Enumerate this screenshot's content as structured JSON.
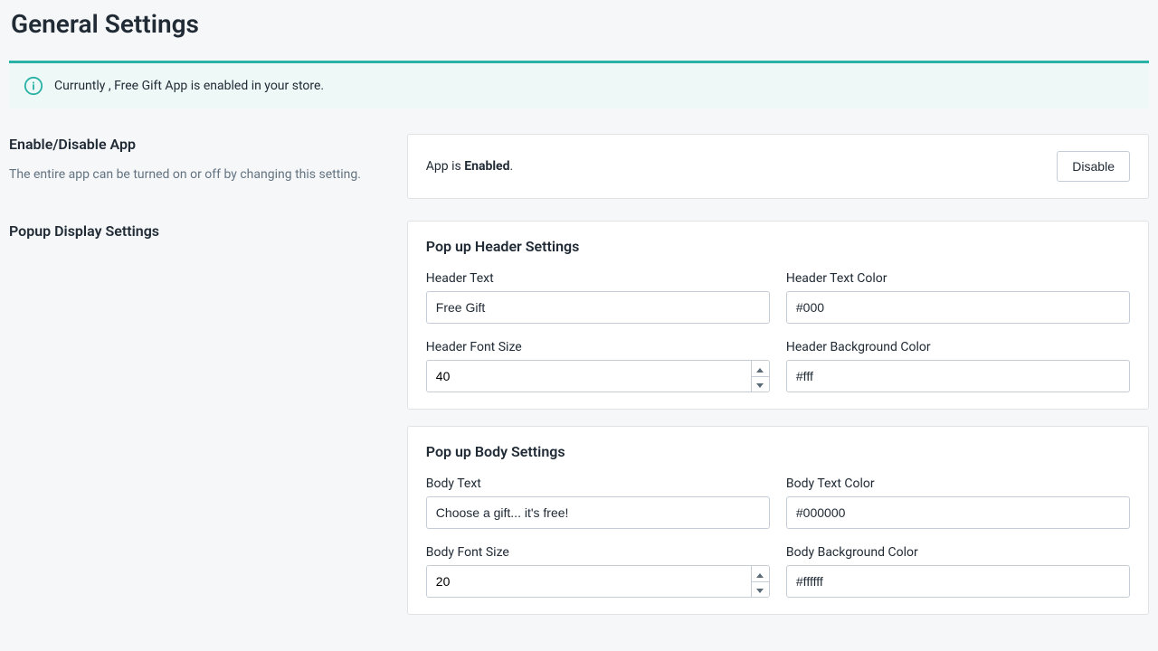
{
  "page": {
    "title": "General Settings"
  },
  "banner": {
    "text": "Curruntly , Free Gift App is enabled in your store."
  },
  "enable_section": {
    "heading": "Enable/Disable App",
    "description": "The entire app can be turned on or off by changing this setting.",
    "status_prefix": "App is ",
    "status_word": "Enabled",
    "status_suffix": ".",
    "button_label": "Disable"
  },
  "popup_section": {
    "heading": "Popup Display Settings"
  },
  "header_settings": {
    "title": "Pop up Header Settings",
    "header_text_label": "Header Text",
    "header_text_value": "Free Gift",
    "header_text_color_label": "Header Text Color",
    "header_text_color_value": "#000",
    "header_font_size_label": "Header Font Size",
    "header_font_size_value": "40",
    "header_bg_color_label": "Header Background Color",
    "header_bg_color_value": "#fff"
  },
  "body_settings": {
    "title": "Pop up Body Settings",
    "body_text_label": "Body Text",
    "body_text_value": "Choose a gift... it's free!",
    "body_text_color_label": "Body Text Color",
    "body_text_color_value": "#000000",
    "body_font_size_label": "Body Font Size",
    "body_font_size_value": "20",
    "body_bg_color_label": "Body Background Color",
    "body_bg_color_value": "#ffffff"
  }
}
